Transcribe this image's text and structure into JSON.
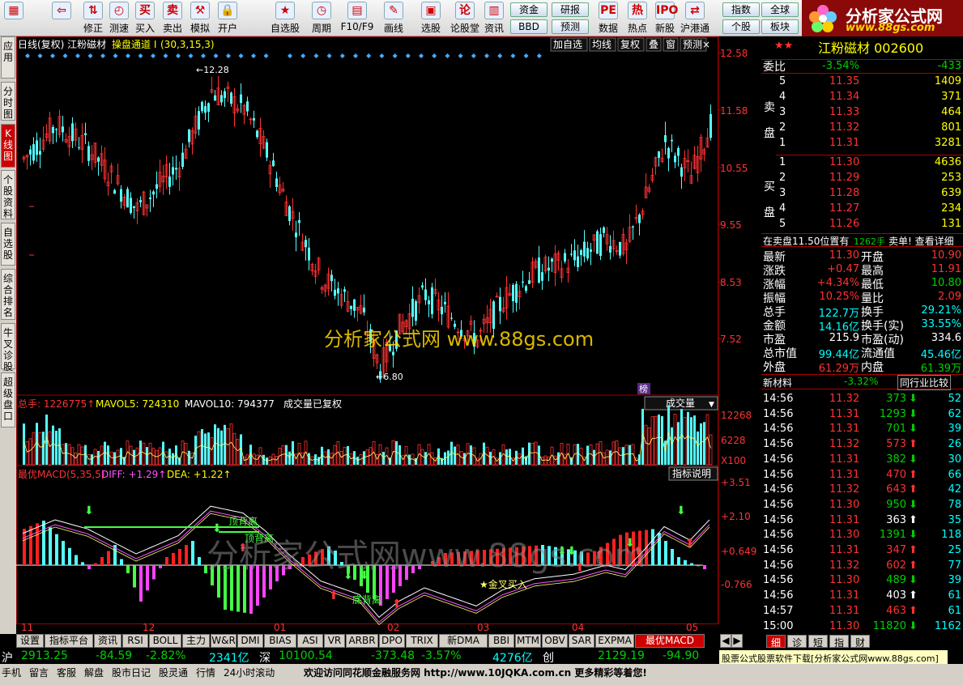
{
  "toolbar": {
    "buttons": [
      {
        "label": "",
        "icon": "windows-icon"
      },
      {
        "label": "",
        "icon": "back-arrow-icon"
      },
      {
        "label": "修正",
        "icon": "up-down-arrow-icon"
      },
      {
        "label": "测速",
        "icon": "clock-icon"
      },
      {
        "label": "买入",
        "icon": "buy-icon"
      },
      {
        "label": "卖出",
        "icon": "sell-icon"
      },
      {
        "label": "模拟",
        "icon": "gavel-icon"
      },
      {
        "label": "开户",
        "icon": "lock-icon"
      },
      {
        "label": "自选股",
        "icon": "star-folder-icon"
      },
      {
        "label": "周期",
        "icon": "period-icon"
      },
      {
        "label": "F10/F9",
        "icon": "f10-icon"
      },
      {
        "label": "画线",
        "icon": "pen-icon"
      },
      {
        "label": "选股",
        "icon": "select-stock-icon"
      },
      {
        "label": "论股堂",
        "icon": "forum-icon"
      },
      {
        "label": "资讯",
        "icon": "news-icon"
      },
      {
        "label": "数据",
        "icon": "pe-icon"
      },
      {
        "label": "热点",
        "icon": "hot-icon"
      },
      {
        "label": "新股",
        "icon": "ipo-icon"
      },
      {
        "label": "沪港通",
        "icon": "sse-hk-icon"
      }
    ],
    "small_buttons": [
      "资金",
      "研报",
      "BBD",
      "预测",
      "指数",
      "全球",
      "个股",
      "板块"
    ]
  },
  "logo": {
    "title": "分析家公式网",
    "url": "www.88gs.com"
  },
  "left_tabs": [
    "应用",
    "分时图",
    "K线图",
    "个股资料",
    "自选股",
    "综合排名",
    "牛叉诊股",
    "超级盘口"
  ],
  "kline": {
    "header": "日线(复权)  江粉磁材",
    "indicator": "操盘通道 I",
    "params": "(30,3,15,3)",
    "buttons": [
      "加自选",
      "均线",
      "复权",
      "叠",
      "窗",
      "预测"
    ],
    "y_ticks": [
      "12.58",
      "11.58",
      "10.55",
      "9.55",
      "8.53",
      "7.52"
    ],
    "high_label": "12.28",
    "low_label": "6.80",
    "watermark": "分析家公式网  www.88gs.com",
    "badge": "榜"
  },
  "volume": {
    "label_total": "总手: 1226775",
    "label_ma5": "MAVOL5: 724310",
    "label_ma10": "MAVOL10: 794377",
    "note": "成交量已复权",
    "dropdown": "成交量",
    "y_ticks": [
      "12268",
      "6228",
      "X100"
    ]
  },
  "macd": {
    "label": "最优MACD(5,35,5)",
    "diff": "DIFF: +1.29",
    "dea": "DEA: +1.22",
    "button": "指标说明",
    "y_ticks": [
      "+3.51",
      "+2.10",
      "+0.649",
      "-0.766"
    ],
    "annotations": [
      "顶背离",
      "顶背离",
      "底背离",
      "金叉买入"
    ],
    "watermark": "分析家公式网www.88gs.com"
  },
  "x_ticks": [
    "11",
    "12",
    "01",
    "02",
    "03",
    "04",
    "05"
  ],
  "right": {
    "title": "江粉磁材 002600",
    "weibi_label": "委比",
    "weibi": "-3.54%",
    "weicha": "-433",
    "sell_label": "卖盘",
    "buy_label": "买盘",
    "sell": [
      {
        "lvl": "5",
        "price": "11.35",
        "vol": "1409"
      },
      {
        "lvl": "4",
        "price": "11.34",
        "vol": "371"
      },
      {
        "lvl": "3",
        "price": "11.33",
        "vol": "464"
      },
      {
        "lvl": "2",
        "price": "11.32",
        "vol": "801"
      },
      {
        "lvl": "1",
        "price": "11.31",
        "vol": "3281"
      }
    ],
    "buy": [
      {
        "lvl": "1",
        "price": "11.30",
        "vol": "4636"
      },
      {
        "lvl": "2",
        "price": "11.29",
        "vol": "253"
      },
      {
        "lvl": "3",
        "price": "11.28",
        "vol": "639"
      },
      {
        "lvl": "4",
        "price": "11.27",
        "vol": "234"
      },
      {
        "lvl": "5",
        "price": "11.26",
        "vol": "131"
      }
    ],
    "notice": "在卖盘11.50位置有",
    "notice_vol": "1262手",
    "notice_tail": "卖单! 查看详细",
    "stats": [
      {
        "k1": "最新",
        "v1": "11.30",
        "c1": "red",
        "k2": "开盘",
        "v2": "10.90",
        "c2": "red"
      },
      {
        "k1": "涨跌",
        "v1": "+0.47",
        "c1": "red",
        "k2": "最高",
        "v2": "11.91",
        "c2": "red"
      },
      {
        "k1": "涨幅",
        "v1": "+4.34%",
        "c1": "red",
        "k2": "最低",
        "v2": "10.80",
        "c2": "grn"
      },
      {
        "k1": "振幅",
        "v1": "10.25%",
        "c1": "red",
        "k2": "量比",
        "v2": "2.09",
        "c2": "red"
      },
      {
        "k1": "总手",
        "v1": "122.7万",
        "c1": "cyn",
        "k2": "换手",
        "v2": "29.21%",
        "c2": "cyn"
      },
      {
        "k1": "金额",
        "v1": "14.16亿",
        "c1": "cyn",
        "k2": "换手(实)",
        "v2": "33.55%",
        "c2": "cyn"
      },
      {
        "k1": "市盈",
        "v1": "215.9",
        "c1": "wht",
        "k2": "市盈(动)",
        "v2": "334.6",
        "c2": "wht"
      },
      {
        "k1": "总市值",
        "v1": "99.44亿",
        "c1": "cyn",
        "k2": "流通值",
        "v2": "45.46亿",
        "c2": "cyn"
      },
      {
        "k1": "外盘",
        "v1": "61.29万",
        "c1": "red",
        "k2": "内盘",
        "v2": "61.39万",
        "c2": "grn"
      }
    ],
    "sector_name": "新材料",
    "sector_chg": "-3.32%",
    "sector_btn": "同行业比较",
    "ticks": [
      {
        "t": "14:56",
        "p": "11.32",
        "pc": "red",
        "v": "373",
        "d": "down",
        "n": "52"
      },
      {
        "t": "14:56",
        "p": "11.31",
        "pc": "red",
        "v": "1293",
        "d": "down",
        "n": "62"
      },
      {
        "t": "14:56",
        "p": "11.31",
        "pc": "red",
        "v": "701",
        "d": "down",
        "n": "39"
      },
      {
        "t": "14:56",
        "p": "11.32",
        "pc": "red",
        "v": "573",
        "d": "up",
        "n": "26"
      },
      {
        "t": "14:56",
        "p": "11.31",
        "pc": "red",
        "v": "382",
        "d": "down",
        "n": "30"
      },
      {
        "t": "14:56",
        "p": "11.31",
        "pc": "red",
        "v": "470",
        "d": "up",
        "n": "66"
      },
      {
        "t": "14:56",
        "p": "11.32",
        "pc": "red",
        "v": "643",
        "d": "up",
        "n": "42"
      },
      {
        "t": "14:56",
        "p": "11.30",
        "pc": "red",
        "v": "950",
        "d": "down",
        "n": "78"
      },
      {
        "t": "14:56",
        "p": "11.31",
        "pc": "red",
        "v": "363",
        "d": "uw",
        "n": "35"
      },
      {
        "t": "14:56",
        "p": "11.30",
        "pc": "red",
        "v": "1391",
        "d": "down",
        "n": "118"
      },
      {
        "t": "14:56",
        "p": "11.31",
        "pc": "red",
        "v": "347",
        "d": "up",
        "n": "25"
      },
      {
        "t": "14:56",
        "p": "11.32",
        "pc": "red",
        "v": "602",
        "d": "up",
        "n": "77"
      },
      {
        "t": "14:56",
        "p": "11.30",
        "pc": "red",
        "v": "489",
        "d": "down",
        "n": "39"
      },
      {
        "t": "14:56",
        "p": "11.31",
        "pc": "red",
        "v": "403",
        "d": "uw",
        "n": "61"
      },
      {
        "t": "14:57",
        "p": "11.31",
        "pc": "red",
        "v": "463",
        "d": "up",
        "n": "61"
      },
      {
        "t": "15:00",
        "p": "11.30",
        "pc": "red",
        "v": "11820",
        "d": "down",
        "n": "1162"
      }
    ],
    "tabs": [
      "细",
      "诊",
      "短",
      "指",
      "财"
    ]
  },
  "bottom_tabs": [
    "设置",
    "指标平台",
    "资讯",
    "RSI",
    "BOLL",
    "主力",
    "W&R",
    "DMI",
    "BIAS",
    "ASI",
    "VR",
    "ARBR",
    "DPO",
    "TRIX",
    "新DMA",
    "BBI",
    "MTM",
    "OBV",
    "SAR",
    "EXPMA",
    "最优MACD"
  ],
  "status": {
    "sh_label": "沪",
    "sh_idx": "2913.25",
    "sh_chg": "-84.59",
    "sh_pct": "-2.82%",
    "sh_amt": "2341亿",
    "sz_label": "深",
    "sz_idx": "10100.54",
    "sz_chg": "-373.48",
    "sz_pct": "-3.57%",
    "sz_amt": "4276亿",
    "cy_label": "创",
    "cy_idx": "2129.19",
    "cy_chg": "-94.90",
    "ad": "股票公式股票软件下载[分析家公式网www.88gs.com]"
  },
  "status2": {
    "items": [
      "手机",
      "留言",
      "客服",
      "解盘",
      "股市日记",
      "股灵通",
      "行情",
      "24小时滚动"
    ],
    "banner": "欢迎访问同花顺金融服务网 http://www.10JQKA.com.cn 更多精彩等着您!"
  },
  "colors": {
    "up": "#ff3232",
    "down": "#54ffff",
    "grid": "#a00000",
    "bg": "#000000"
  }
}
